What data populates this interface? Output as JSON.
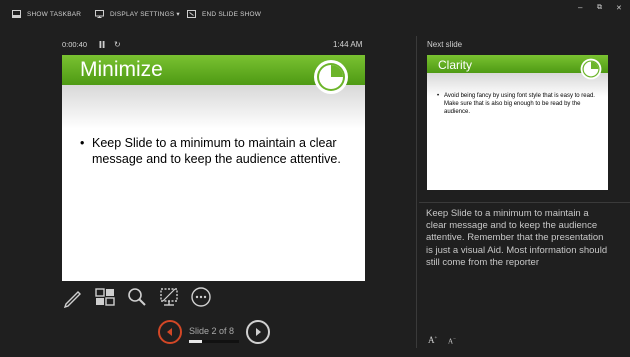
{
  "toolbar": {
    "show_taskbar": "SHOW TASKBAR",
    "display_settings": "DISPLAY SETTINGS ▾",
    "end_slide_show": "END SLIDE SHOW"
  },
  "window": {
    "minimize": "–",
    "restore": "⧉",
    "close": "✕"
  },
  "presenter": {
    "timer": "0:00:40",
    "clock": "1:44 AM"
  },
  "current_slide": {
    "title": "Minimize",
    "bullet": "Keep Slide to a minimum to maintain a clear message and to keep the audience attentive."
  },
  "navigation": {
    "counter": "Slide 2 of 8",
    "progress_fraction": 0.25
  },
  "next_slide": {
    "label": "Next slide",
    "title": "Clarity",
    "bullet": "Avoid being fancy by using font style that is easy to read. Make sure that is also big enough to be read by the audience."
  },
  "notes": {
    "text": "Keep Slide to a minimum to maintain a clear message and to keep the audience attentive. Remember that the presentation is just a visual Aid. Most information should still come from the reporter"
  },
  "font_controls": {
    "increase": "A",
    "decrease": "A"
  },
  "colors": {
    "accent_green": "#5aa81e",
    "prev_button": "#d24726",
    "background": "#1f1f1f"
  },
  "icons": [
    "taskbar-icon",
    "display-icon",
    "end-show-icon",
    "pause-icon",
    "reset-icon",
    "pen-icon",
    "all-slides-icon",
    "zoom-icon",
    "black-screen-icon",
    "more-options-icon",
    "previous-arrow-icon",
    "next-arrow-icon"
  ]
}
